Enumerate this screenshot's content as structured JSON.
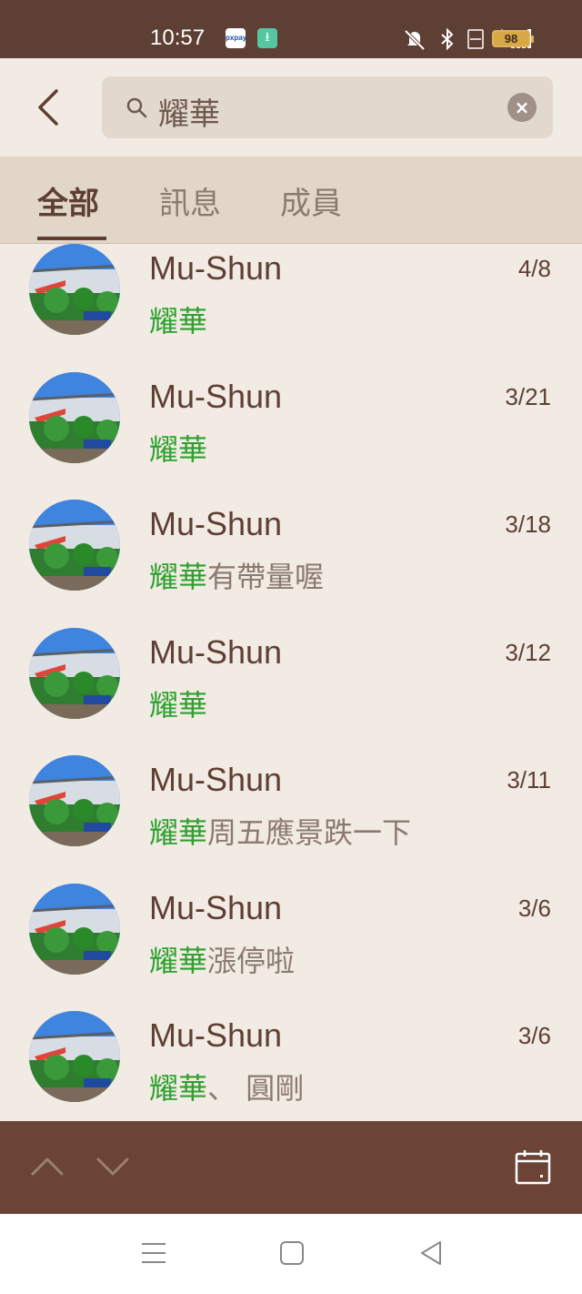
{
  "status_bar": {
    "time": "10:57",
    "pay_icon": "pxpay",
    "battery": "98"
  },
  "search": {
    "query": "耀華"
  },
  "tabs": [
    {
      "label": "全部",
      "active": true
    },
    {
      "label": "訊息",
      "active": false
    },
    {
      "label": "成員",
      "active": false
    }
  ],
  "results": [
    {
      "name": "Mu-Shun",
      "date": "4/8",
      "highlight": "耀華",
      "rest": ""
    },
    {
      "name": "Mu-Shun",
      "date": "3/21",
      "highlight": "耀華",
      "rest": ""
    },
    {
      "name": "Mu-Shun",
      "date": "3/18",
      "highlight": "耀華",
      "rest": "有帶量喔"
    },
    {
      "name": "Mu-Shun",
      "date": "3/12",
      "highlight": "耀華",
      "rest": ""
    },
    {
      "name": "Mu-Shun",
      "date": "3/11",
      "highlight": "耀華",
      "rest": "周五應景跌一下"
    },
    {
      "name": "Mu-Shun",
      "date": "3/6",
      "highlight": "耀華",
      "rest": "漲停啦"
    },
    {
      "name": "Mu-Shun",
      "date": "3/6",
      "highlight": "耀華",
      "rest": "、 圓剛"
    }
  ],
  "colors": {
    "brand_brown": "#5e3f33",
    "highlight_green": "#2ea02e",
    "background": "#f1ebe4"
  }
}
